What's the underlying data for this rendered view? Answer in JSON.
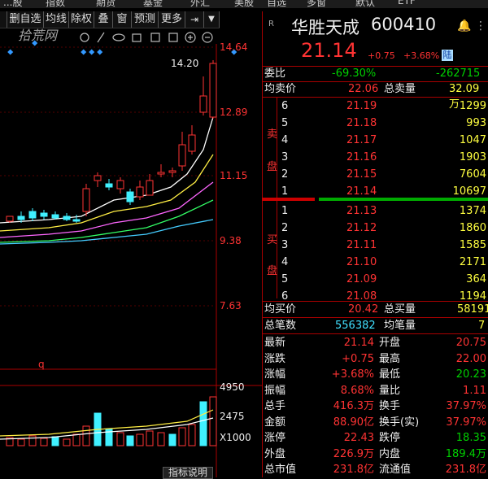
{
  "top_tabs_left": [
    "...股",
    "指数",
    "期货",
    "基金",
    "外汇",
    "美股"
  ],
  "top_tabs_right": [
    "自选",
    "多窗",
    "默认",
    "ETF"
  ],
  "toolbar": [
    "删自选",
    "均线",
    "除权",
    "叠",
    "窗",
    "预测",
    "更多"
  ],
  "watermark": "拾荒网",
  "stock": {
    "name": "华胜天成",
    "code": "600410",
    "price": "21.14",
    "change": "+0.75",
    "change_pct": "+3.68%",
    "badge": "陆",
    "r_label": "R"
  },
  "price_axis": [
    "14.64",
    "12.89",
    "11.15",
    "9.38",
    "7.63"
  ],
  "max_label": "14.20",
  "q_label": "q",
  "vol_axis": [
    "4950",
    "2475",
    "X1000"
  ],
  "footer_tab": "指标说明",
  "weibi": {
    "label": "委比",
    "pct": "-69.30%",
    "diff": "-262715"
  },
  "avg_sell": {
    "label": "均卖价",
    "value": "22.06",
    "total_label": "总卖量",
    "total": "32.09万"
  },
  "sell_label": [
    "卖",
    "盘"
  ],
  "buy_label": [
    "买",
    "盘"
  ],
  "sells": [
    {
      "n": "6",
      "price": "21.19",
      "vol": "1299"
    },
    {
      "n": "5",
      "price": "21.18",
      "vol": "993"
    },
    {
      "n": "4",
      "price": "21.17",
      "vol": "1047"
    },
    {
      "n": "3",
      "price": "21.16",
      "vol": "1903"
    },
    {
      "n": "2",
      "price": "21.15",
      "vol": "7604"
    },
    {
      "n": "1",
      "price": "21.14",
      "vol": "10697"
    }
  ],
  "buys": [
    {
      "n": "1",
      "price": "21.13",
      "vol": "1374"
    },
    {
      "n": "2",
      "price": "21.12",
      "vol": "1860"
    },
    {
      "n": "3",
      "price": "21.11",
      "vol": "1585"
    },
    {
      "n": "4",
      "price": "21.10",
      "vol": "2171"
    },
    {
      "n": "5",
      "price": "21.09",
      "vol": "364"
    },
    {
      "n": "6",
      "price": "21.08",
      "vol": "1194"
    }
  ],
  "avg_buy": {
    "label": "均买价",
    "value": "20.42",
    "total_label": "总买量",
    "total": "58191"
  },
  "deals": {
    "label": "总笔数",
    "value": "556382",
    "avg_label": "均笔量",
    "avg": "7"
  },
  "stats": [
    {
      "l1": "最新",
      "v1": "21.14",
      "c1": "red",
      "l2": "开盘",
      "v2": "20.75",
      "c2": "red"
    },
    {
      "l1": "涨跌",
      "v1": "+0.75",
      "c1": "red",
      "l2": "最高",
      "v2": "22.00",
      "c2": "red"
    },
    {
      "l1": "涨幅",
      "v1": "+3.68%",
      "c1": "red",
      "l2": "最低",
      "v2": "20.23",
      "c2": "green"
    },
    {
      "l1": "振幅",
      "v1": "8.68%",
      "c1": "red",
      "l2": "量比",
      "v2": "1.11",
      "c2": "red"
    },
    {
      "l1": "总手",
      "v1": "416.3万",
      "c1": "red",
      "l2": "换手",
      "v2": "37.97%",
      "c2": "red"
    },
    {
      "l1": "金额",
      "v1": "88.90亿",
      "c1": "red",
      "l2": "换手(实)",
      "v2": "37.97%",
      "c2": "red"
    },
    {
      "l1": "涨停",
      "v1": "22.43",
      "c1": "red",
      "l2": "跌停",
      "v2": "18.35",
      "c2": "green"
    },
    {
      "l1": "外盘",
      "v1": "226.9万",
      "c1": "red",
      "l2": "内盘",
      "v2": "189.4万",
      "c2": "green"
    },
    {
      "l1": "总市值",
      "v1": "231.8亿",
      "c1": "red",
      "l2": "流通值",
      "v2": "231.8亿",
      "c2": "red"
    }
  ],
  "colors": {
    "up": "#ff3333",
    "down": "#00d000",
    "vol_up": "#ff3333",
    "vol_down": "#40f0ff"
  }
}
